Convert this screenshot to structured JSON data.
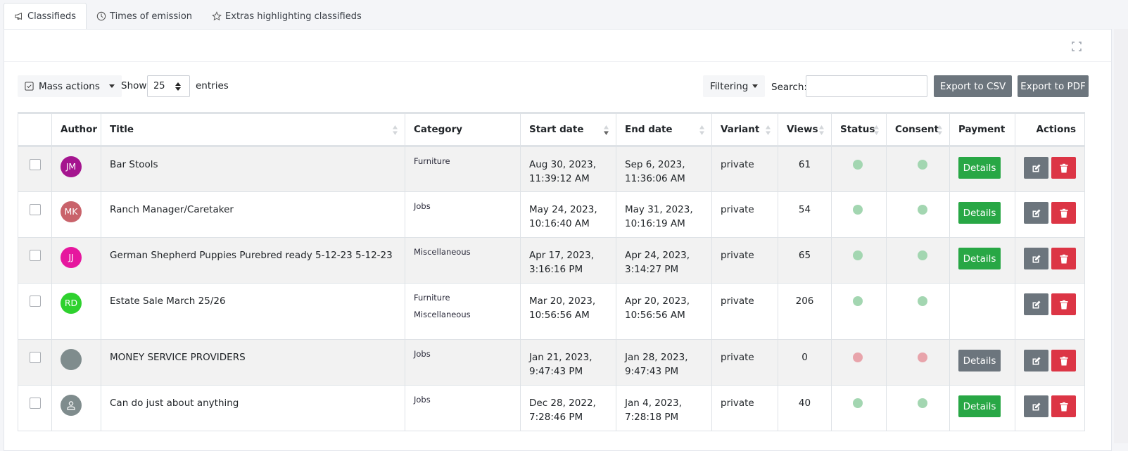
{
  "tabs": [
    {
      "label": "Classifieds",
      "icon": "megaphone-icon",
      "active": true
    },
    {
      "label": "Times of emission",
      "icon": "clock-icon",
      "active": false
    },
    {
      "label": "Extras highlighting classifieds",
      "icon": "star-icon",
      "active": false
    }
  ],
  "toolbar": {
    "mass_actions_label": "Mass actions",
    "show_label": "Show",
    "page_length": "25",
    "entries_label": "entries",
    "filtering_label": "Filtering",
    "search_label": "Search:",
    "search_value": "",
    "export_csv_label": "Export to CSV",
    "export_pdf_label": "Export to PDF"
  },
  "colors": {
    "success": "#28a745",
    "secondary": "#6c757d",
    "danger": "#dc3545",
    "status_active": "#a3d6b1",
    "status_inactive": "#e8a4ab"
  },
  "table": {
    "columns": [
      "",
      "Author",
      "Title",
      "Category",
      "Start date",
      "End date",
      "Variant",
      "Views",
      "Status",
      "Consent",
      "Payment",
      "Actions"
    ],
    "rows": [
      {
        "initials": "JM",
        "avatar_color": "#a5158f",
        "title": "Bar Stools",
        "categories": [
          "Furniture"
        ],
        "start_date": "Aug 30, 2023,",
        "start_time": "11:39:12 AM",
        "end_date": "Sep 6, 2023,",
        "end_time": "11:36:06 AM",
        "variant": "private",
        "views": "61",
        "status": "active",
        "consent": "active",
        "payment": "Details",
        "payment_style": "success"
      },
      {
        "initials": "MK",
        "avatar_color": "#c9636b",
        "title": "Ranch Manager/Caretaker",
        "categories": [
          "Jobs"
        ],
        "start_date": "May 24, 2023,",
        "start_time": "10:16:40 AM",
        "end_date": "May 31, 2023,",
        "end_time": "10:16:19 AM",
        "variant": "private",
        "views": "54",
        "status": "active",
        "consent": "active",
        "payment": "Details",
        "payment_style": "success"
      },
      {
        "initials": "JJ",
        "avatar_color": "#e6179e",
        "title": "German Shepherd Puppies Purebred ready 5-12-23 5-12-23",
        "categories": [
          "Miscellaneous"
        ],
        "start_date": "Apr 17, 2023,",
        "start_time": "3:16:16 PM",
        "end_date": "Apr 24, 2023,",
        "end_time": "3:14:27 PM",
        "variant": "private",
        "views": "65",
        "status": "active",
        "consent": "active",
        "payment": "Details",
        "payment_style": "success"
      },
      {
        "initials": "RD",
        "avatar_color": "#2ed12e",
        "title": "Estate Sale March 25/26",
        "categories": [
          "Furniture",
          "Miscellaneous"
        ],
        "start_date": "Mar 20, 2023,",
        "start_time": "10:56:56 AM",
        "end_date": "Apr 20, 2023,",
        "end_time": "10:56:56 AM",
        "variant": "private",
        "views": "206",
        "status": "active",
        "consent": "active",
        "payment": "",
        "payment_style": "none"
      },
      {
        "initials": "",
        "avatar_color": "#7f8c8d",
        "title": "MONEY SERVICE PROVIDERS",
        "categories": [
          "Jobs"
        ],
        "start_date": "Jan 21, 2023,",
        "start_time": "9:47:43 PM",
        "end_date": "Jan 28, 2023,",
        "end_time": "9:47:43 PM",
        "variant": "private",
        "views": "0",
        "status": "inactive",
        "consent": "inactive",
        "payment": "Details",
        "payment_style": "secondary"
      },
      {
        "initials": "",
        "avatar_icon": "user-icon",
        "avatar_color": "#7f8c8d",
        "title": "Can do just about anything",
        "categories": [
          "Jobs"
        ],
        "start_date": "Dec 28, 2022,",
        "start_time": "7:28:46 PM",
        "end_date": "Jan 4, 2023,",
        "end_time": "7:28:18 PM",
        "variant": "private",
        "views": "40",
        "status": "active",
        "consent": "active",
        "payment": "Details",
        "payment_style": "success"
      }
    ]
  }
}
